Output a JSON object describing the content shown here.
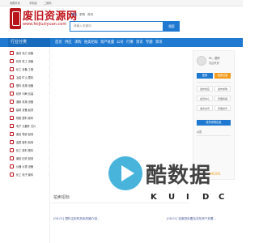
{
  "topbar": {
    "links": [
      "收藏本页",
      "手机版",
      "二维码"
    ]
  },
  "header": {
    "logo_title": "废旧资源网",
    "logo_url": "www.feijiuziyuan.com",
    "search_tabs": [
      "供应",
      "求购",
      "资讯"
    ],
    "search_placeholder": "请输入关键词",
    "search_button": "搜索"
  },
  "nav": {
    "category_label": "行业分类",
    "items": [
      "首页",
      "供应",
      "求购",
      "拍卖招标",
      "资产处置",
      "公司",
      "行情",
      "资讯",
      "专题",
      "资讯"
    ]
  },
  "sidebar": {
    "items": [
      {
        "label": "废旧 电力 设备"
      },
      {
        "label": "机床 机工 设备"
      },
      {
        "label": "化工 设备 工程"
      },
      {
        "label": "冶金 矿山 整机"
      },
      {
        "label": "塑料 机械 设备"
      },
      {
        "label": "纺织 印刷 包装"
      },
      {
        "label": "通用 机械 设备"
      },
      {
        "label": "建筑 设备 起重"
      },
      {
        "label": "橡胶 塑料 原料"
      },
      {
        "label": "电子 元器件 芯片"
      },
      {
        "label": "废旧 物资 回收"
      },
      {
        "label": "金属 废料 回收"
      },
      {
        "label": "化工 原料 塑料"
      },
      {
        "label": "废纸 旧衣 回收"
      },
      {
        "label": "仪器 仪表 设备"
      },
      {
        "label": "化工 电子 废料"
      }
    ]
  },
  "right_panel": {
    "greeting": "Hi，您好",
    "welcome": "欢迎来到",
    "login_button": "登录",
    "register_button": "免费注册",
    "grid_a": [
      "发布供应",
      "发布求购"
    ],
    "grid_b": [
      "会员中心",
      "管理商铺"
    ],
    "grid_c": [
      "发布资讯",
      "管理资讯"
    ],
    "blue_button": "发布采购信息",
    "section_label": "公告",
    "price_text": "¥6500"
  },
  "content": {
    "bottom_title": "拍卖招标",
    "line_left": "[08-01] 塑料注射机拍卖机器介绍...",
    "line_right": "[08-01] 如废铁处置及无形资产处置..."
  },
  "watermark": {
    "text": "酷数据",
    "letters": [
      "K",
      "U",
      "I",
      "D",
      "C"
    ]
  },
  "colors": {
    "brand_red": "#c1121a",
    "nav_blue": "#1f79d0",
    "orange": "#f29b1c",
    "watermark_blue": "#3aaed8"
  }
}
